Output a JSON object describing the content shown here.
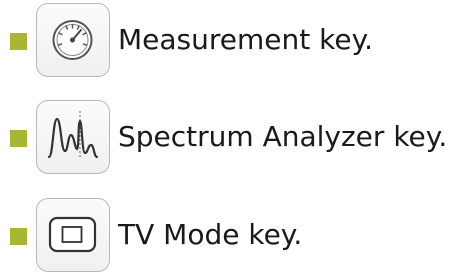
{
  "accent_color": "#a8b633",
  "keys": [
    {
      "label": "Measurement key.",
      "icon": "gauge-icon"
    },
    {
      "label": "Spectrum Analyzer key.",
      "icon": "spectrum-icon"
    },
    {
      "label": "TV Mode key.",
      "icon": "tv-screen-icon"
    }
  ]
}
